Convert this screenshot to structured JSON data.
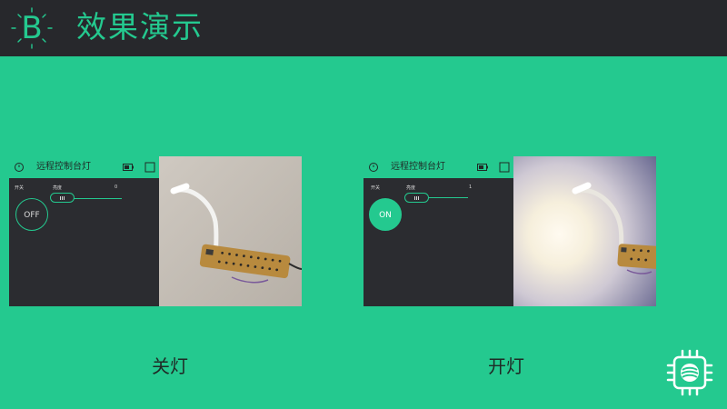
{
  "header": {
    "logo_letter": "B",
    "title": "效果演示"
  },
  "panels": [
    {
      "app_title": "远程控制台灯",
      "switch_label": "开关",
      "slider_label": "亮度",
      "slider_value": "0",
      "button_label": "OFF",
      "button_state": "off"
    },
    {
      "app_title": "远程控制台灯",
      "switch_label": "开关",
      "slider_label": "亮度",
      "slider_value": "1",
      "button_label": "ON",
      "button_state": "on"
    }
  ],
  "captions": {
    "left": "关灯",
    "right": "开灯"
  },
  "icons": {
    "logo": "blynk-logo-icon",
    "device": "device-icon",
    "battery": "battery-icon",
    "square": "square-icon",
    "badge": "chip-logo-icon"
  },
  "colors": {
    "accent": "#24c98f",
    "topbar": "#27282c",
    "app_bg": "#2b2c30"
  }
}
